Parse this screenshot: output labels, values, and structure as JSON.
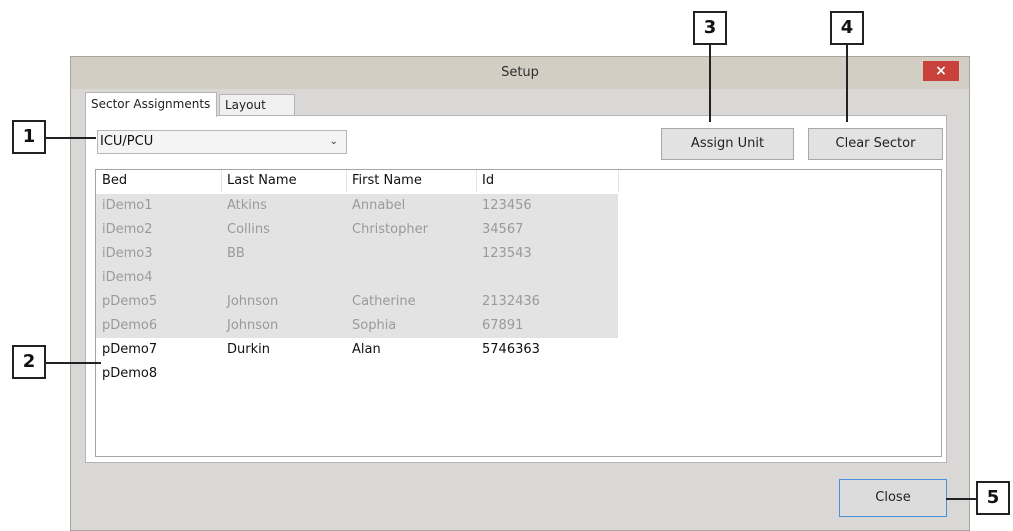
{
  "window": {
    "title": "Setup",
    "close_glyph": "×"
  },
  "tabs": [
    {
      "label": "Sector Assignments",
      "active": true
    },
    {
      "label": "Layout",
      "active": false
    }
  ],
  "unit_select": {
    "value": "ICU/PCU"
  },
  "buttons": {
    "assign_unit": "Assign Unit",
    "clear_sector": "Clear Sector",
    "close": "Close"
  },
  "table": {
    "columns": [
      "Bed",
      "Last Name",
      "First Name",
      "Id"
    ],
    "rows": [
      {
        "bed": "iDemo1",
        "last": "Atkins",
        "first": "Annabel",
        "id": "123456",
        "assigned": true
      },
      {
        "bed": "iDemo2",
        "last": "Collins",
        "first": "Christopher",
        "id": "34567",
        "assigned": true
      },
      {
        "bed": "iDemo3",
        "last": "BB",
        "first": "",
        "id": "123543",
        "assigned": true
      },
      {
        "bed": "iDemo4",
        "last": "",
        "first": "",
        "id": "",
        "assigned": true
      },
      {
        "bed": "pDemo5",
        "last": "Johnson",
        "first": "Catherine",
        "id": "2132436",
        "assigned": true
      },
      {
        "bed": "pDemo6",
        "last": "Johnson",
        "first": "Sophia",
        "id": "67891",
        "assigned": true
      },
      {
        "bed": "pDemo7",
        "last": "Durkin",
        "first": "Alan",
        "id": "5746363",
        "assigned": false
      },
      {
        "bed": "pDemo8",
        "last": "",
        "first": "",
        "id": "",
        "assigned": false
      }
    ]
  },
  "callouts": [
    "1",
    "2",
    "3",
    "4",
    "5"
  ],
  "colors": {
    "title_close": "#c9413b",
    "assigned_row_bg": "#e3e3e3",
    "focus_border": "#4a90d9"
  },
  "icons": {
    "dropdown": "chevron-down-icon",
    "close": "close-icon"
  }
}
